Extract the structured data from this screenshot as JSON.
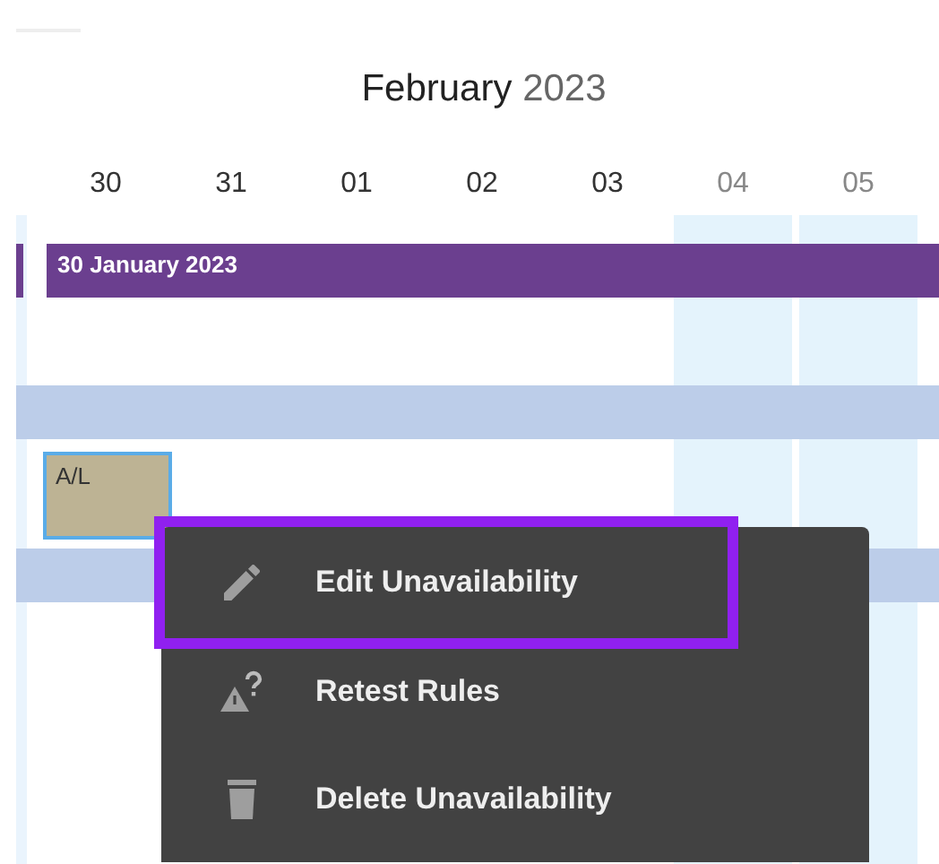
{
  "calendar": {
    "month": "February",
    "year": "2023",
    "days": [
      {
        "label": "30",
        "weekend": false
      },
      {
        "label": "31",
        "weekend": false
      },
      {
        "label": "01",
        "weekend": false
      },
      {
        "label": "02",
        "weekend": false
      },
      {
        "label": "03",
        "weekend": false
      },
      {
        "label": "04",
        "weekend": true
      },
      {
        "label": "05",
        "weekend": true
      }
    ],
    "banner": {
      "label": "30 January 2023"
    },
    "unavailability": {
      "label": "A/L",
      "selected": true
    }
  },
  "context_menu": {
    "items": [
      {
        "kind": "edit",
        "label": "Edit Unavailability",
        "selected": true
      },
      {
        "kind": "retest",
        "label": "Retest Rules",
        "selected": false
      },
      {
        "kind": "delete",
        "label": "Delete Unavailability",
        "selected": false
      }
    ]
  }
}
